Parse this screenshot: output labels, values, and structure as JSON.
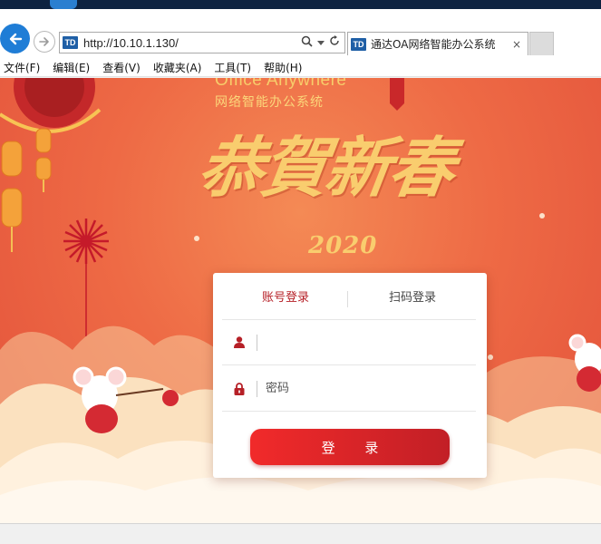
{
  "browser": {
    "address_url": "http://10.10.1.130/",
    "tab_title": "通达OA网络智能办公系统",
    "site_badge": "TD",
    "tab_close": "×"
  },
  "menu": [
    {
      "label": "文件(F)"
    },
    {
      "label": "编辑(E)"
    },
    {
      "label": "查看(V)"
    },
    {
      "label": "收藏夹(A)"
    },
    {
      "label": "工具(T)"
    },
    {
      "label": "帮助(H)"
    }
  ],
  "page": {
    "brand_en": "Office Anywhere",
    "brand_cn": "网络智能办公系统",
    "greeting": "恭賀新春",
    "year": "2020"
  },
  "login": {
    "tab_account": "账号登录",
    "tab_qrcode": "扫码登录",
    "username_value": "",
    "password_placeholder": "密码",
    "submit_label": "登 录"
  },
  "colors": {
    "accent": "#b62027",
    "button_start": "#f12a2a",
    "button_end": "#c21f26",
    "background_orange": "#ee6a45",
    "gold_text": "#f9cd6e"
  },
  "icons": {
    "back": "arrow-left-icon",
    "forward": "arrow-right-icon",
    "search": "search-icon",
    "refresh": "refresh-icon",
    "user": "user-icon",
    "lock": "lock-icon"
  }
}
